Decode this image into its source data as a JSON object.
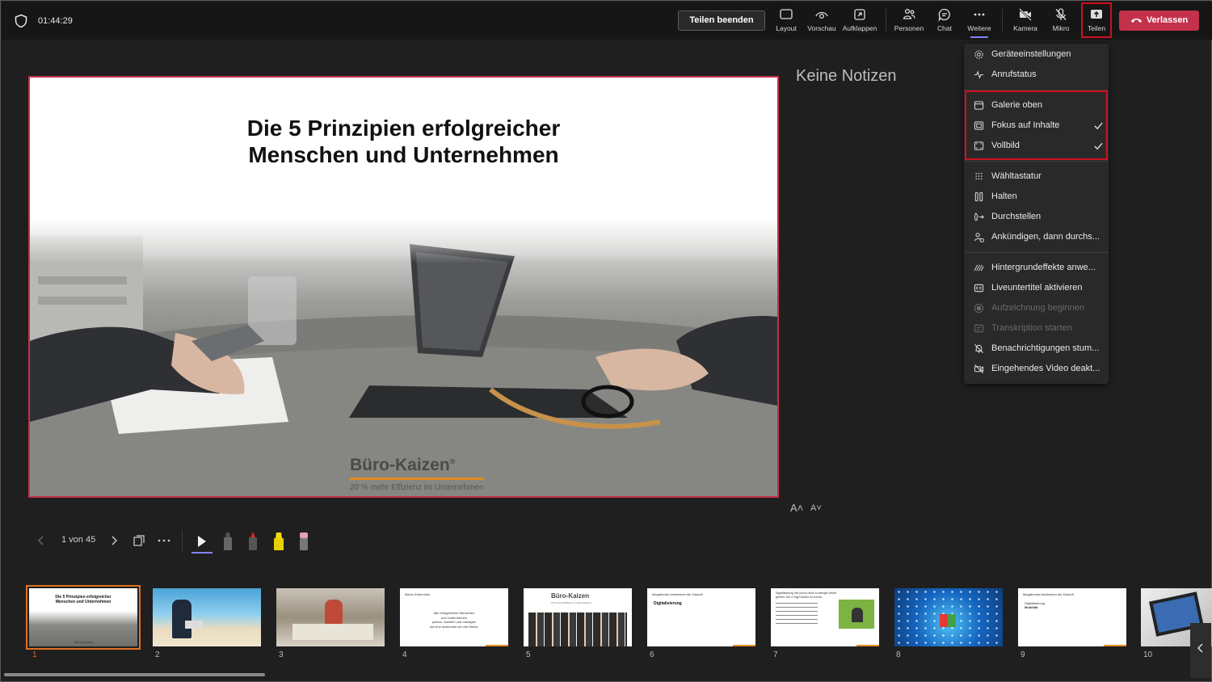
{
  "header": {
    "timer": "01:44:29",
    "stop_sharing_label": "Teilen beenden",
    "leave_label": "Verlassen",
    "tools": [
      {
        "label": "Layout",
        "icon": "layout-icon"
      },
      {
        "label": "Vorschau",
        "icon": "eye-icon"
      },
      {
        "label": "Aufklappen",
        "icon": "expand-icon"
      },
      {
        "label": "Personen",
        "icon": "people-icon"
      },
      {
        "label": "Chat",
        "icon": "chat-icon"
      },
      {
        "label": "Weitere",
        "icon": "more-icon"
      },
      {
        "label": "Kamera",
        "icon": "camera-off-icon"
      },
      {
        "label": "Mikro",
        "icon": "mic-off-icon"
      },
      {
        "label": "Teilen",
        "icon": "share-icon"
      }
    ]
  },
  "slide": {
    "title_line1": "Die 5 Prinzipien erfolgreicher",
    "title_line2": "Menschen und Unternehmen",
    "logo_name": "Büro-Kaizen",
    "logo_registered": "®",
    "logo_tagline": "20 % mehr Effizienz im Unternehmen"
  },
  "notes": {
    "text": "Keine Notizen",
    "font_up": "A˄",
    "font_down": "A˅"
  },
  "slide_controls": {
    "counter": "1 von 45"
  },
  "menu": {
    "items": [
      {
        "label": "Geräteeinstellungen",
        "icon": "gear-icon"
      },
      {
        "label": "Anrufstatus",
        "icon": "pulse-icon"
      },
      {
        "label": "Galerie oben",
        "icon": "gallery-icon"
      },
      {
        "label": "Fokus auf Inhalte",
        "icon": "focus-icon",
        "checked": true
      },
      {
        "label": "Vollbild",
        "icon": "fullscreen-icon",
        "checked": true
      },
      {
        "label": "Wähltastatur",
        "icon": "dialpad-icon"
      },
      {
        "label": "Halten",
        "icon": "pause-icon"
      },
      {
        "label": "Durchstellen",
        "icon": "transfer-icon"
      },
      {
        "label": "Ankündigen, dann durchs...",
        "icon": "consult-icon"
      },
      {
        "label": "Hintergrundeffekte anwe...",
        "icon": "background-effects-icon"
      },
      {
        "label": "Liveuntertitel aktivieren",
        "icon": "captions-icon"
      },
      {
        "label": "Aufzeichnung beginnen",
        "icon": "record-icon",
        "disabled": true
      },
      {
        "label": "Transkription starten",
        "icon": "transcript-icon",
        "disabled": true
      },
      {
        "label": "Benachrichtigungen stum...",
        "icon": "bell-mute-icon"
      },
      {
        "label": "Eingehendes Video deakt...",
        "icon": "video-off-icon"
      }
    ]
  },
  "thumbnails": {
    "numbers": [
      "1",
      "2",
      "3",
      "4",
      "5",
      "6",
      "7",
      "8",
      "9",
      "10"
    ],
    "t1_title_1": "Die 5 Prinzipien erfolgreicher",
    "t1_title_2": "Menschen und Unternehmen",
    "t1_logo": "Büro-Kaizen",
    "t4_head": "Meine Erkenntnis",
    "t4_body_1": "Alle erfolgreichen Menschen",
    "t4_body_2": "und Unternehmen",
    "t4_body_3": "planen, handeln und managen",
    "t4_body_4": "auf eine bestimmte Art und Weise.",
    "t5_logo": "Büro-Kaizen",
    "t5_tagline": "20 % mehr Effizienz im Unternehmen",
    "t6_head": "Megatrends bestimmen die Zukunft",
    "t6_body": "Digitalisierung",
    "t7_head_1": "Digitalisierung hat (noch) nicht zu weniger Arbeit",
    "t7_head_2": "geführt. Die 4 Tage Woche ist zurück",
    "t9_head": "Megatrends bestimmen die Zukunft",
    "t9_body_1": "Digitalisierung",
    "t9_body_2": "Mobilität"
  },
  "colors": {
    "accent": "#7f85f5",
    "leave": "#c4314b",
    "highlight": "#d01020",
    "selected_thumb": "#e07020",
    "logo_orange": "#e08a1e"
  }
}
